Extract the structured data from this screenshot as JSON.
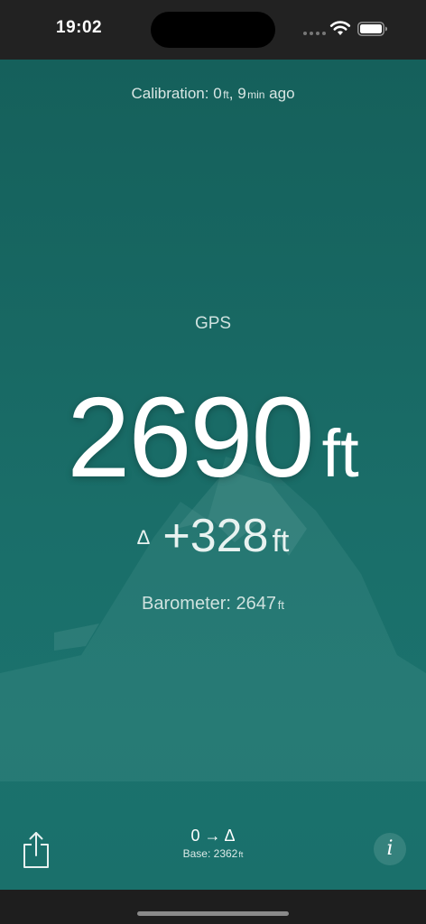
{
  "status_bar": {
    "time": "19:02"
  },
  "calibration": {
    "prefix": "Calibration: ",
    "value": "0",
    "unit": "ft",
    "separator": ", ",
    "minutes": "9",
    "minutes_unit": "min",
    "suffix": " ago"
  },
  "gps": {
    "label": "GPS",
    "altitude": "2690",
    "unit": "ft"
  },
  "delta": {
    "symbol": "Δ",
    "value": "+328",
    "unit": "ft"
  },
  "barometer": {
    "label": "Barometer: 2647",
    "unit": "ft"
  },
  "bottom_bar": {
    "mode": "0 → Δ",
    "base_label": "Base: 2362",
    "base_unit": "ft",
    "info_label": "i"
  },
  "icons": {
    "share": "share-icon",
    "info": "info-icon",
    "wifi": "wifi-icon",
    "battery": "battery-icon",
    "mountain": "mountain-icon"
  },
  "colors": {
    "teal_background": "#176661",
    "status_bar": "#222222",
    "text_primary": "#ffffff"
  }
}
